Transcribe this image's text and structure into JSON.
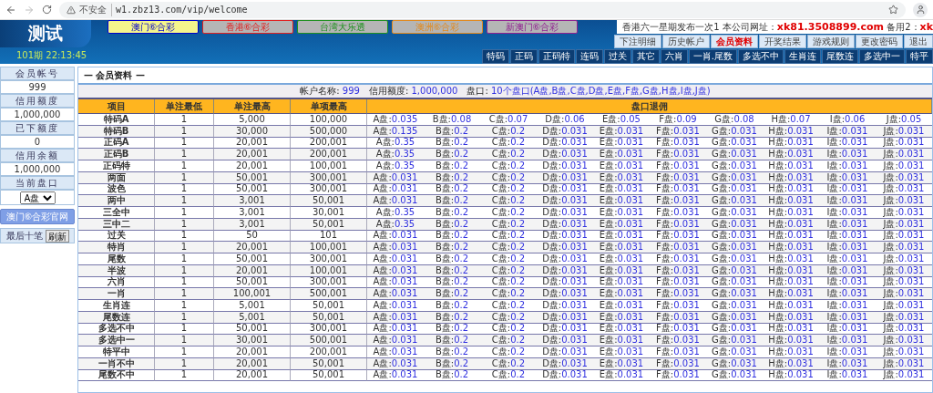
{
  "browser": {
    "security": "不安全",
    "url": "w1.zbz13.com/vip/welcome"
  },
  "header": {
    "logo": "测试",
    "period": "101期 22:13:45",
    "lottery_tabs": [
      {
        "label": "澳门⑥合彩",
        "selected": true,
        "color": "#0000cc"
      },
      {
        "label": "香港⑥合彩",
        "selected": false,
        "color": "#e02020"
      },
      {
        "label": "台湾大乐透",
        "selected": false,
        "color": "#209020"
      },
      {
        "label": "澳洲⑥合彩",
        "selected": false,
        "color": "#e08a20"
      },
      {
        "label": "新澳门⑥合彩",
        "selected": false,
        "color": "#902090"
      }
    ],
    "notice": [
      {
        "text": "香港六一星期发布一次1 本公司网址：",
        "kind": "plain"
      },
      {
        "text": "xk81.3508899.com",
        "kind": "highlight"
      },
      {
        "text": " 备用2：",
        "kind": "plain"
      },
      {
        "text": "xk",
        "kind": "highlight"
      }
    ],
    "menu": [
      {
        "label": "下注明细",
        "selected": false
      },
      {
        "label": "历史帐户",
        "selected": false
      },
      {
        "label": "会员资料",
        "selected": true
      },
      {
        "label": "开奖结果",
        "selected": false
      },
      {
        "label": "游戏规则",
        "selected": false
      },
      {
        "label": "更改密码",
        "selected": false
      },
      {
        "label": "退出",
        "selected": false
      }
    ],
    "game_tabs": [
      "特码",
      "正码",
      "正码特",
      "连码",
      "过关",
      "其它",
      "六肖",
      "一肖.尾数",
      "多选不中",
      "生肖连",
      "尾数连",
      "多选中一",
      "特平"
    ]
  },
  "sidebar": {
    "fields": [
      {
        "label": "会员帐号",
        "value": "999"
      },
      {
        "label": "信用额度",
        "value": "1,000,000"
      },
      {
        "label": "已下额度",
        "value": "0"
      },
      {
        "label": "信用余额",
        "value": "1,000,000"
      }
    ],
    "plate_label": "当前盘口",
    "plate": "A盘",
    "site_button": "澳门⑥合彩官网",
    "recent_label": "最后十笔",
    "refresh_button": "刷新"
  },
  "panel": {
    "title": "— 会员资料 —",
    "info": [
      {
        "label": "帐户名称:",
        "value": "999"
      },
      {
        "label": "信用额度:",
        "value": "1,000,000"
      },
      {
        "label": "盘口:",
        "value": "10个盘口(A盘,B盘,C盘,D盘,E盘,F盘,G盘,H盘,I盘,J盘)"
      }
    ],
    "columns": [
      "项目",
      "单注最低",
      "单注最高",
      "单项最高",
      "盘口退佣"
    ],
    "rows": [
      {
        "item": "特码A",
        "min": "1",
        "max": "5,000",
        "item_max": "100,000",
        "rates": [
          [
            "A盘:",
            "0.035"
          ],
          [
            "B盘:",
            "0.08"
          ],
          [
            "C盘:",
            "0.07"
          ],
          [
            "D盘:",
            "0.06"
          ],
          [
            "E盘:",
            "0.05"
          ],
          [
            "F盘:",
            "0.09"
          ],
          [
            "G盘:",
            "0.08"
          ],
          [
            "H盘:",
            "0.07"
          ],
          [
            "I盘:",
            "0.06"
          ],
          [
            "J盘:",
            "0.05"
          ]
        ]
      },
      {
        "item": "特码B",
        "min": "1",
        "max": "30,000",
        "item_max": "500,000",
        "rates": [
          [
            "A盘:",
            "0.135"
          ],
          [
            "B盘:",
            "0.2"
          ],
          [
            "C盘:",
            "0.2"
          ],
          [
            "D盘:",
            "0.031"
          ],
          [
            "E盘:",
            "0.031"
          ],
          [
            "F盘:",
            "0.031"
          ],
          [
            "G盘:",
            "0.031"
          ],
          [
            "H盘:",
            "0.031"
          ],
          [
            "I盘:",
            "0.031"
          ],
          [
            "J盘:",
            "0.031"
          ]
        ]
      },
      {
        "item": "正码A",
        "min": "1",
        "max": "20,001",
        "item_max": "200,001",
        "rates": [
          [
            "A盘:",
            "0.35"
          ],
          [
            "B盘:",
            "0.2"
          ],
          [
            "C盘:",
            "0.2"
          ],
          [
            "D盘:",
            "0.031"
          ],
          [
            "E盘:",
            "0.031"
          ],
          [
            "F盘:",
            "0.031"
          ],
          [
            "G盘:",
            "0.031"
          ],
          [
            "H盘:",
            "0.031"
          ],
          [
            "I盘:",
            "0.031"
          ],
          [
            "J盘:",
            "0.031"
          ]
        ]
      },
      {
        "item": "正码B",
        "min": "1",
        "max": "20,001",
        "item_max": "200,001",
        "rates": [
          [
            "A盘:",
            "0.35"
          ],
          [
            "B盘:",
            "0.2"
          ],
          [
            "C盘:",
            "0.2"
          ],
          [
            "D盘:",
            "0.031"
          ],
          [
            "E盘:",
            "0.031"
          ],
          [
            "F盘:",
            "0.031"
          ],
          [
            "G盘:",
            "0.031"
          ],
          [
            "H盘:",
            "0.031"
          ],
          [
            "I盘:",
            "0.031"
          ],
          [
            "J盘:",
            "0.031"
          ]
        ]
      },
      {
        "item": "正码特",
        "min": "1",
        "max": "20,001",
        "item_max": "100,001",
        "rates": [
          [
            "A盘:",
            "0.35"
          ],
          [
            "B盘:",
            "0.2"
          ],
          [
            "C盘:",
            "0.2"
          ],
          [
            "D盘:",
            "0.031"
          ],
          [
            "E盘:",
            "0.031"
          ],
          [
            "F盘:",
            "0.031"
          ],
          [
            "G盘:",
            "0.031"
          ],
          [
            "H盘:",
            "0.031"
          ],
          [
            "I盘:",
            "0.031"
          ],
          [
            "J盘:",
            "0.031"
          ]
        ]
      },
      {
        "item": "两面",
        "min": "1",
        "max": "50,001",
        "item_max": "300,001",
        "rates": [
          [
            "A盘:",
            "0.031"
          ],
          [
            "B盘:",
            "0.2"
          ],
          [
            "C盘:",
            "0.2"
          ],
          [
            "D盘:",
            "0.031"
          ],
          [
            "E盘:",
            "0.031"
          ],
          [
            "F盘:",
            "0.031"
          ],
          [
            "G盘:",
            "0.031"
          ],
          [
            "H盘:",
            "0.031"
          ],
          [
            "I盘:",
            "0.031"
          ],
          [
            "J盘:",
            "0.031"
          ]
        ]
      },
      {
        "item": "波色",
        "min": "1",
        "max": "50,001",
        "item_max": "300,001",
        "rates": [
          [
            "A盘:",
            "0.031"
          ],
          [
            "B盘:",
            "0.2"
          ],
          [
            "C盘:",
            "0.2"
          ],
          [
            "D盘:",
            "0.031"
          ],
          [
            "E盘:",
            "0.031"
          ],
          [
            "F盘:",
            "0.031"
          ],
          [
            "G盘:",
            "0.031"
          ],
          [
            "H盘:",
            "0.031"
          ],
          [
            "I盘:",
            "0.031"
          ],
          [
            "J盘:",
            "0.031"
          ]
        ]
      },
      {
        "item": "两中",
        "min": "1",
        "max": "3,001",
        "item_max": "50,001",
        "rates": [
          [
            "A盘:",
            "0.031"
          ],
          [
            "B盘:",
            "0.2"
          ],
          [
            "C盘:",
            "0.2"
          ],
          [
            "D盘:",
            "0.031"
          ],
          [
            "E盘:",
            "0.031"
          ],
          [
            "F盘:",
            "0.031"
          ],
          [
            "G盘:",
            "0.031"
          ],
          [
            "H盘:",
            "0.031"
          ],
          [
            "I盘:",
            "0.031"
          ],
          [
            "J盘:",
            "0.031"
          ]
        ]
      },
      {
        "item": "三全中",
        "min": "1",
        "max": "3,001",
        "item_max": "30,001",
        "rates": [
          [
            "A盘:",
            "0.35"
          ],
          [
            "B盘:",
            "0.2"
          ],
          [
            "C盘:",
            "0.2"
          ],
          [
            "D盘:",
            "0.031"
          ],
          [
            "E盘:",
            "0.031"
          ],
          [
            "F盘:",
            "0.031"
          ],
          [
            "G盘:",
            "0.031"
          ],
          [
            "H盘:",
            "0.031"
          ],
          [
            "I盘:",
            "0.031"
          ],
          [
            "J盘:",
            "0.031"
          ]
        ]
      },
      {
        "item": "三中二",
        "min": "1",
        "max": "3,001",
        "item_max": "50,001",
        "rates": [
          [
            "A盘:",
            "0.35"
          ],
          [
            "B盘:",
            "0.2"
          ],
          [
            "C盘:",
            "0.2"
          ],
          [
            "D盘:",
            "0.031"
          ],
          [
            "E盘:",
            "0.031"
          ],
          [
            "F盘:",
            "0.031"
          ],
          [
            "G盘:",
            "0.031"
          ],
          [
            "H盘:",
            "0.031"
          ],
          [
            "I盘:",
            "0.031"
          ],
          [
            "J盘:",
            "0.031"
          ]
        ]
      },
      {
        "item": "过关",
        "min": "1",
        "max": "50",
        "item_max": "101",
        "rates": [
          [
            "A盘:",
            "0.031"
          ],
          [
            "B盘:",
            "0.2"
          ],
          [
            "C盘:",
            "0.2"
          ],
          [
            "D盘:",
            "0.031"
          ],
          [
            "E盘:",
            "0.031"
          ],
          [
            "F盘:",
            "0.031"
          ],
          [
            "G盘:",
            "0.031"
          ],
          [
            "H盘:",
            "0.031"
          ],
          [
            "I盘:",
            "0.031"
          ],
          [
            "J盘:",
            "0.031"
          ]
        ]
      },
      {
        "item": "特肖",
        "min": "1",
        "max": "20,001",
        "item_max": "100,001",
        "rates": [
          [
            "A盘:",
            "0.031"
          ],
          [
            "B盘:",
            "0.2"
          ],
          [
            "C盘:",
            "0.2"
          ],
          [
            "D盘:",
            "0.031"
          ],
          [
            "E盘:",
            "0.031"
          ],
          [
            "F盘:",
            "0.031"
          ],
          [
            "G盘:",
            "0.031"
          ],
          [
            "H盘:",
            "0.031"
          ],
          [
            "I盘:",
            "0.031"
          ],
          [
            "J盘:",
            "0.031"
          ]
        ]
      },
      {
        "item": "尾数",
        "min": "1",
        "max": "50,001",
        "item_max": "300,001",
        "rates": [
          [
            "A盘:",
            "0.031"
          ],
          [
            "B盘:",
            "0.2"
          ],
          [
            "C盘:",
            "0.2"
          ],
          [
            "D盘:",
            "0.031"
          ],
          [
            "E盘:",
            "0.031"
          ],
          [
            "F盘:",
            "0.031"
          ],
          [
            "G盘:",
            "0.031"
          ],
          [
            "H盘:",
            "0.031"
          ],
          [
            "I盘:",
            "0.031"
          ],
          [
            "J盘:",
            "0.031"
          ]
        ]
      },
      {
        "item": "半波",
        "min": "1",
        "max": "20,001",
        "item_max": "100,001",
        "rates": [
          [
            "A盘:",
            "0.031"
          ],
          [
            "B盘:",
            "0.2"
          ],
          [
            "C盘:",
            "0.2"
          ],
          [
            "D盘:",
            "0.031"
          ],
          [
            "E盘:",
            "0.031"
          ],
          [
            "F盘:",
            "0.031"
          ],
          [
            "G盘:",
            "0.031"
          ],
          [
            "H盘:",
            "0.031"
          ],
          [
            "I盘:",
            "0.031"
          ],
          [
            "J盘:",
            "0.031"
          ]
        ]
      },
      {
        "item": "六肖",
        "min": "1",
        "max": "50,001",
        "item_max": "300,001",
        "rates": [
          [
            "A盘:",
            "0.031"
          ],
          [
            "B盘:",
            "0.2"
          ],
          [
            "C盘:",
            "0.2"
          ],
          [
            "D盘:",
            "0.031"
          ],
          [
            "E盘:",
            "0.031"
          ],
          [
            "F盘:",
            "0.031"
          ],
          [
            "G盘:",
            "0.031"
          ],
          [
            "H盘:",
            "0.031"
          ],
          [
            "I盘:",
            "0.031"
          ],
          [
            "J盘:",
            "0.031"
          ]
        ]
      },
      {
        "item": "一肖",
        "min": "1",
        "max": "100,001",
        "item_max": "500,001",
        "rates": [
          [
            "A盘:",
            "0.031"
          ],
          [
            "B盘:",
            "0.2"
          ],
          [
            "C盘:",
            "0.2"
          ],
          [
            "D盘:",
            "0.031"
          ],
          [
            "E盘:",
            "0.031"
          ],
          [
            "F盘:",
            "0.031"
          ],
          [
            "G盘:",
            "0.031"
          ],
          [
            "H盘:",
            "0.031"
          ],
          [
            "I盘:",
            "0.031"
          ],
          [
            "J盘:",
            "0.031"
          ]
        ]
      },
      {
        "item": "生肖连",
        "min": "1",
        "max": "5,001",
        "item_max": "50,001",
        "rates": [
          [
            "A盘:",
            "0.031"
          ],
          [
            "B盘:",
            "0.2"
          ],
          [
            "C盘:",
            "0.2"
          ],
          [
            "D盘:",
            "0.031"
          ],
          [
            "E盘:",
            "0.031"
          ],
          [
            "F盘:",
            "0.031"
          ],
          [
            "G盘:",
            "0.031"
          ],
          [
            "H盘:",
            "0.031"
          ],
          [
            "I盘:",
            "0.031"
          ],
          [
            "J盘:",
            "0.031"
          ]
        ]
      },
      {
        "item": "尾数连",
        "min": "1",
        "max": "5,001",
        "item_max": "50,001",
        "rates": [
          [
            "A盘:",
            "0.031"
          ],
          [
            "B盘:",
            "0.2"
          ],
          [
            "C盘:",
            "0.2"
          ],
          [
            "D盘:",
            "0.031"
          ],
          [
            "E盘:",
            "0.031"
          ],
          [
            "F盘:",
            "0.031"
          ],
          [
            "G盘:",
            "0.031"
          ],
          [
            "H盘:",
            "0.031"
          ],
          [
            "I盘:",
            "0.031"
          ],
          [
            "J盘:",
            "0.031"
          ]
        ]
      },
      {
        "item": "多选不中",
        "min": "1",
        "max": "50,001",
        "item_max": "300,001",
        "rates": [
          [
            "A盘:",
            "0.031"
          ],
          [
            "B盘:",
            "0.2"
          ],
          [
            "C盘:",
            "0.2"
          ],
          [
            "D盘:",
            "0.031"
          ],
          [
            "E盘:",
            "0.031"
          ],
          [
            "F盘:",
            "0.031"
          ],
          [
            "G盘:",
            "0.031"
          ],
          [
            "H盘:",
            "0.031"
          ],
          [
            "I盘:",
            "0.031"
          ],
          [
            "J盘:",
            "0.031"
          ]
        ]
      },
      {
        "item": "多选中一",
        "min": "1",
        "max": "30,001",
        "item_max": "500,001",
        "rates": [
          [
            "A盘:",
            "0.031"
          ],
          [
            "B盘:",
            "0.2"
          ],
          [
            "C盘:",
            "0.2"
          ],
          [
            "D盘:",
            "0.031"
          ],
          [
            "E盘:",
            "0.031"
          ],
          [
            "F盘:",
            "0.031"
          ],
          [
            "G盘:",
            "0.031"
          ],
          [
            "H盘:",
            "0.031"
          ],
          [
            "I盘:",
            "0.031"
          ],
          [
            "J盘:",
            "0.031"
          ]
        ]
      },
      {
        "item": "特平中",
        "min": "1",
        "max": "20,001",
        "item_max": "200,001",
        "rates": [
          [
            "A盘:",
            "0.031"
          ],
          [
            "B盘:",
            "0.2"
          ],
          [
            "C盘:",
            "0.2"
          ],
          [
            "D盘:",
            "0.031"
          ],
          [
            "E盘:",
            "0.031"
          ],
          [
            "F盘:",
            "0.031"
          ],
          [
            "G盘:",
            "0.031"
          ],
          [
            "H盘:",
            "0.031"
          ],
          [
            "I盘:",
            "0.031"
          ],
          [
            "J盘:",
            "0.031"
          ]
        ]
      },
      {
        "item": "一肖不中",
        "min": "1",
        "max": "20,001",
        "item_max": "50,001",
        "rates": [
          [
            "A盘:",
            "0.031"
          ],
          [
            "B盘:",
            "0.2"
          ],
          [
            "C盘:",
            "0.2"
          ],
          [
            "D盘:",
            "0.031"
          ],
          [
            "E盘:",
            "0.031"
          ],
          [
            "F盘:",
            "0.031"
          ],
          [
            "G盘:",
            "0.031"
          ],
          [
            "H盘:",
            "0.031"
          ],
          [
            "I盘:",
            "0.031"
          ],
          [
            "J盘:",
            "0.031"
          ]
        ]
      },
      {
        "item": "尾数不中",
        "min": "1",
        "max": "20,001",
        "item_max": "50,001",
        "rates": [
          [
            "A盘:",
            "0.031"
          ],
          [
            "B盘:",
            "0.2"
          ],
          [
            "C盘:",
            "0.2"
          ],
          [
            "D盘:",
            "0.031"
          ],
          [
            "E盘:",
            "0.031"
          ],
          [
            "F盘:",
            "0.031"
          ],
          [
            "G盘:",
            "0.031"
          ],
          [
            "H盘:",
            "0.031"
          ],
          [
            "I盘:",
            "0.031"
          ],
          [
            "J盘:",
            "0.031"
          ]
        ]
      }
    ]
  }
}
